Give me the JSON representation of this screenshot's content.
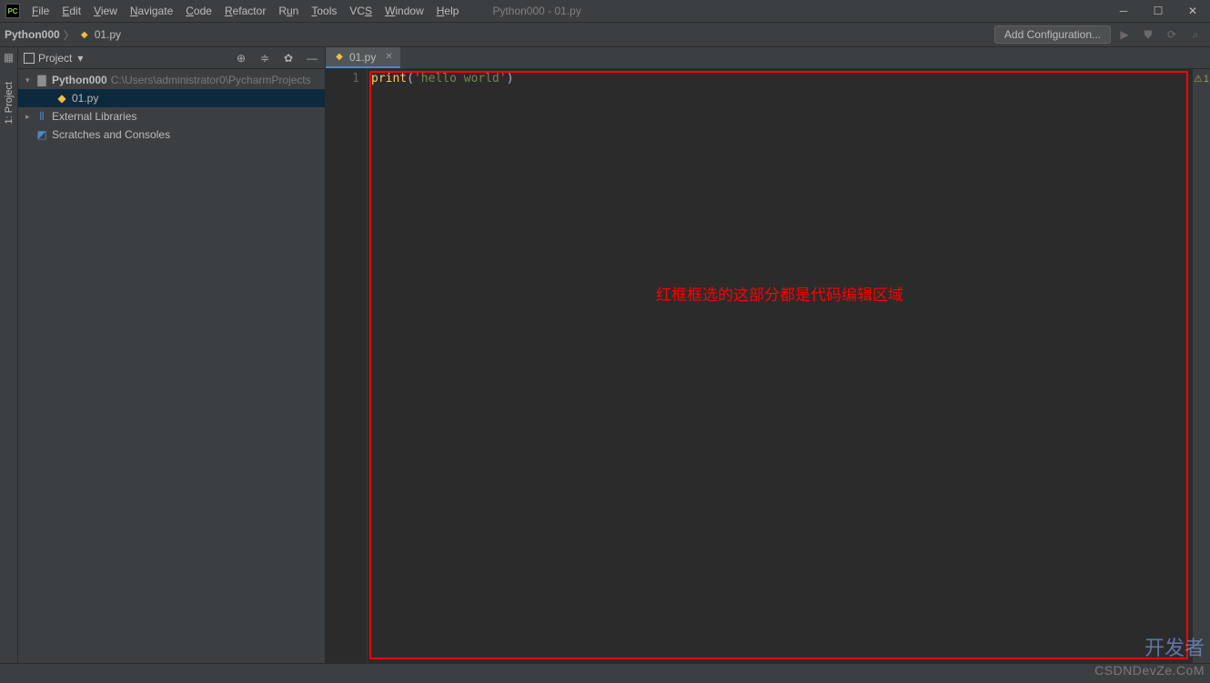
{
  "title": "Python000 - 01.py",
  "menu": [
    "File",
    "Edit",
    "View",
    "Navigate",
    "Code",
    "Refactor",
    "Run",
    "Tools",
    "VCS",
    "Window",
    "Help"
  ],
  "breadcrumb": {
    "project": "Python000",
    "file": "01.py"
  },
  "navbar": {
    "add_config": "Add Configuration..."
  },
  "sidebar_strip": "1: Project",
  "tool": {
    "title": "Project"
  },
  "tree": {
    "project": {
      "name": "Python000",
      "path": "C:\\Users\\administrator0\\PycharmProjects"
    },
    "file": "01.py",
    "ext_libs": "External Libraries",
    "scratches": "Scratches and Consoles"
  },
  "tab": {
    "name": "01.py"
  },
  "editor": {
    "line_num": "1",
    "code": {
      "fn": "print",
      "lpar": "(",
      "str": "'hello world'",
      "rpar": ")"
    },
    "annotation": "红框框选的这部分都是代码编辑区域"
  },
  "right": {
    "warn_count": "1"
  },
  "watermark": {
    "line1a": "开发者",
    "line1b": "",
    "line2": "CSDNDevZe.CoM"
  }
}
